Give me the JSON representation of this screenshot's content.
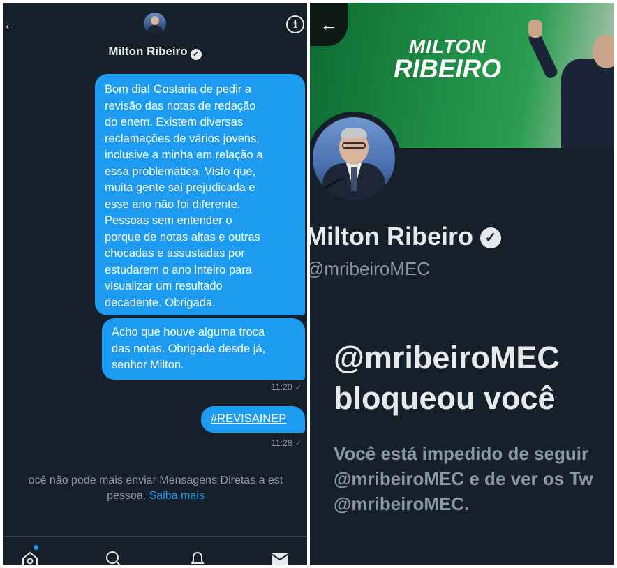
{
  "dm": {
    "back_icon": "←",
    "info_icon": "i",
    "contact_name": "Milton Ribeiro",
    "verified_icon": "✓",
    "messages": [
      {
        "text": "Bom dia! Gostaria de pedir a\nrevisão das notas de redação\ndo enem. Existem diversas\nreclamações de vários jovens,\ninclusive a minha em relação  a\nessa problemática. Visto que,\nmuita gente sai prejudicada e\nesse ano não foi diferente.\nPessoas sem entender o\nporque de notas altas e outras\nchocadas e assustadas por\nestudarem o ano inteiro para\nvisualizar um resultado\ndecadente. Obrigada."
      },
      {
        "text": "Acho que houve alguma troca\ndas notas. Obrigada desde já,\nsenhor Milton.",
        "time": "11:20"
      },
      {
        "text": "#REVISAINEP",
        "time": "11:28"
      }
    ],
    "read_icon": "✓",
    "notice": "ocê não pode mais enviar Mensagens Diretas a est",
    "notice_line2": "pessoa.",
    "notice_link": "Saiba mais",
    "tabs": [
      "home-icon",
      "search-icon",
      "notifications-icon",
      "messages-icon"
    ]
  },
  "profile": {
    "back_icon": "←",
    "banner_line1": "MILTON",
    "banner_line2": "RIBEIRO",
    "name": "Milton Ribeiro",
    "verified_icon": "✓",
    "handle": "@mribeiroMEC",
    "blocked_line1": "@mribeiroMEC",
    "blocked_line2": "bloqueou você",
    "desc_line1": "Você está impedido de seguir",
    "desc_line2": "@mribeiroMEC e de ver os Tw",
    "desc_line3": "@mribeiroMEC."
  },
  "colors": {
    "background": "#15202b",
    "accent": "#1d9bf0",
    "text_primary": "#e7e9ea",
    "text_secondary": "#8b98a5",
    "banner_green": "#1f8d45"
  }
}
